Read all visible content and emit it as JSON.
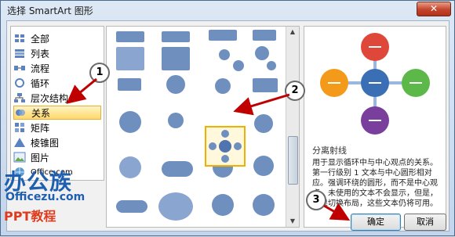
{
  "window": {
    "title": "选择 SmartArt 图形",
    "close_label": "✕"
  },
  "categories": [
    {
      "label": "全部",
      "icon": "grid-icon"
    },
    {
      "label": "列表",
      "icon": "list-icon"
    },
    {
      "label": "流程",
      "icon": "process-icon"
    },
    {
      "label": "循环",
      "icon": "cycle-icon"
    },
    {
      "label": "层次结构",
      "icon": "hierarchy-icon"
    },
    {
      "label": "关系",
      "icon": "relationship-icon",
      "selected": true
    },
    {
      "label": "矩阵",
      "icon": "matrix-icon"
    },
    {
      "label": "棱锥图",
      "icon": "pyramid-icon"
    },
    {
      "label": "图片",
      "icon": "picture-icon"
    },
    {
      "label": "Office.com",
      "icon": "globe-icon"
    }
  ],
  "preview": {
    "title": "分离射线",
    "description": "用于显示循环中与中心观点的关系。第一行级别 1 文本与中心圆形相对应。强调环绕的圆形，而不是中心观点。未使用的文本不会显示，但是，如果切换布局，这些文本仍将可用。"
  },
  "buttons": {
    "ok": "确定",
    "cancel": "取消"
  },
  "annotations": [
    "1",
    "2",
    "3"
  ],
  "watermark": {
    "brand": "办公族",
    "site": "Officezu.com",
    "subtitle": "PPT教程"
  },
  "colors": {
    "accent": "#f0b000",
    "blue": "#3a6fb5",
    "red": "#e0473b",
    "green": "#5db84a",
    "purple": "#7a3f9d",
    "orange": "#f39a1a"
  }
}
